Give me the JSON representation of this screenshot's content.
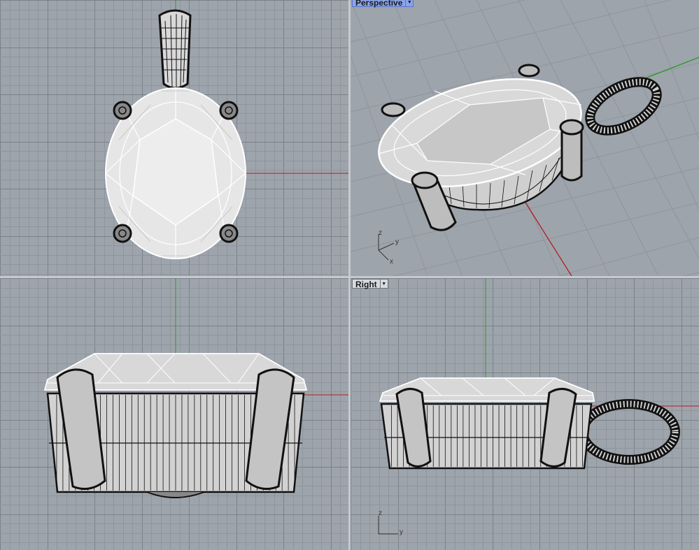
{
  "viewports": {
    "perspective": {
      "label": "Perspective"
    },
    "right": {
      "label": "Right"
    }
  },
  "axis_labels": {
    "z": "z",
    "y": "y",
    "x": "x"
  },
  "colors": {
    "viewport_bg": "#9ea4ab",
    "grid_minor": "#8f959c",
    "grid_major": "#7b8189",
    "x_axis": "#b02020",
    "y_axis": "#2a9a2a",
    "active_tab": "#8ba4ea",
    "wire_dark": "#111111",
    "wire_light": "#ffffff"
  },
  "icons": {
    "dropdown": "caret-down-icon"
  }
}
